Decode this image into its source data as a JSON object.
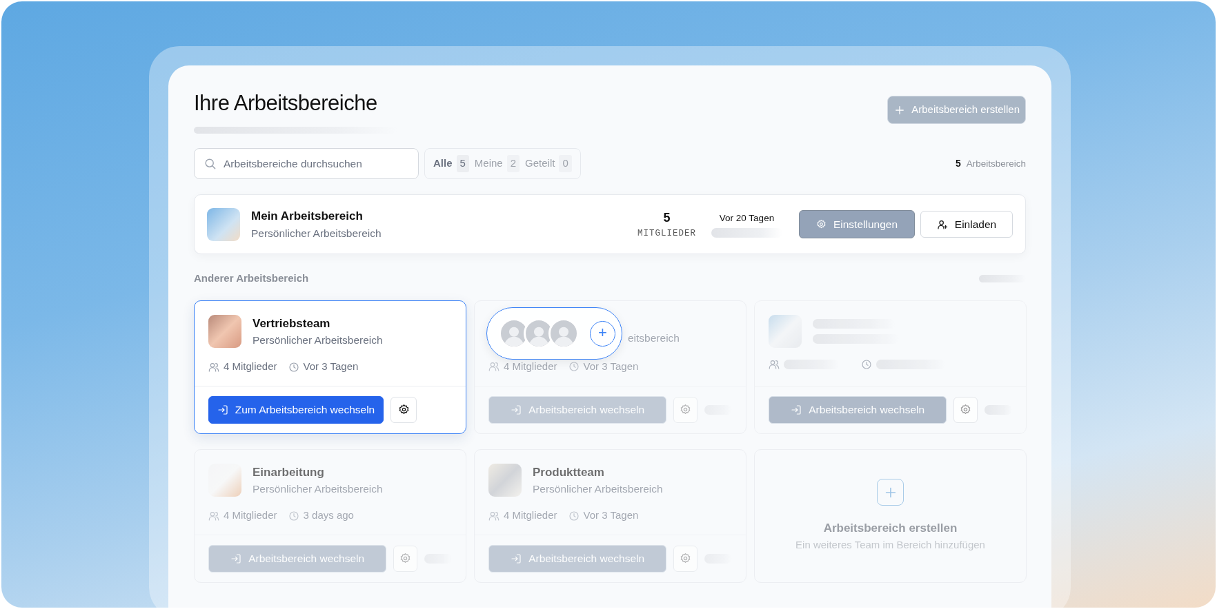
{
  "header": {
    "title": "Ihre Arbeitsbereiche",
    "create_button": "Arbeitsbereich erstellen"
  },
  "search": {
    "placeholder": "Arbeitsbereiche durchsuchen"
  },
  "filters": [
    {
      "label": "Alle",
      "count": "5",
      "selected": true
    },
    {
      "label": "Meine",
      "count": "2",
      "selected": false
    },
    {
      "label": "Geteilt",
      "count": "0",
      "selected": false
    }
  ],
  "total": {
    "count": "5",
    "label": "Arbeitsbereich"
  },
  "current": {
    "title": "Mein Arbeitsbereich",
    "subtitle": "Persönlicher Arbeitsbereich",
    "members": "5",
    "members_label": "MITGLIEDER",
    "updated": "Vor 20 Tagen",
    "settings_button": "Einstellungen",
    "invite_button": "Einladen"
  },
  "section": {
    "title": "Anderer Arbeitsbereich"
  },
  "workspaces": [
    {
      "kind": "team",
      "selected": true,
      "title": "Vertriebsteam",
      "subtitle": "Persönlicher Arbeitsbereich",
      "members": "4 Mitglieder",
      "updated": "Vor 3 Tagen",
      "button": "Zum Arbeitsbereich wechseln"
    },
    {
      "kind": "team",
      "selected": false,
      "subtitle": "eitsbereich",
      "members": "4 Mitglieder",
      "updated": "Vor 3 Tagen",
      "button": "Arbeitsbereich wechseln"
    },
    {
      "kind": "loading",
      "selected": false,
      "button": "Arbeitsbereich wechseln"
    },
    {
      "kind": "team",
      "selected": false,
      "title": "Einarbeitung",
      "subtitle": "Persönlicher Arbeitsbereich",
      "members": "4 Mitglieder",
      "updated": "3 days ago",
      "button": "Arbeitsbereich wechseln"
    },
    {
      "kind": "team",
      "selected": false,
      "title": "Produktteam",
      "subtitle": "Persönlicher Arbeitsbereich",
      "members": "4 Mitglieder",
      "updated": "Vor 3 Tagen",
      "button": "Arbeitsbereich wechseln"
    },
    {
      "kind": "create",
      "selected": false,
      "title": "Arbeitsbereich erstellen",
      "subtitle": "Ein weiteres Team im Bereich hinzufügen"
    }
  ],
  "member_popover": {
    "avatars": [
      {
        "kind": "photo"
      },
      {
        "kind": "photo"
      },
      {
        "kind": "photo"
      }
    ],
    "add_button": "+"
  }
}
